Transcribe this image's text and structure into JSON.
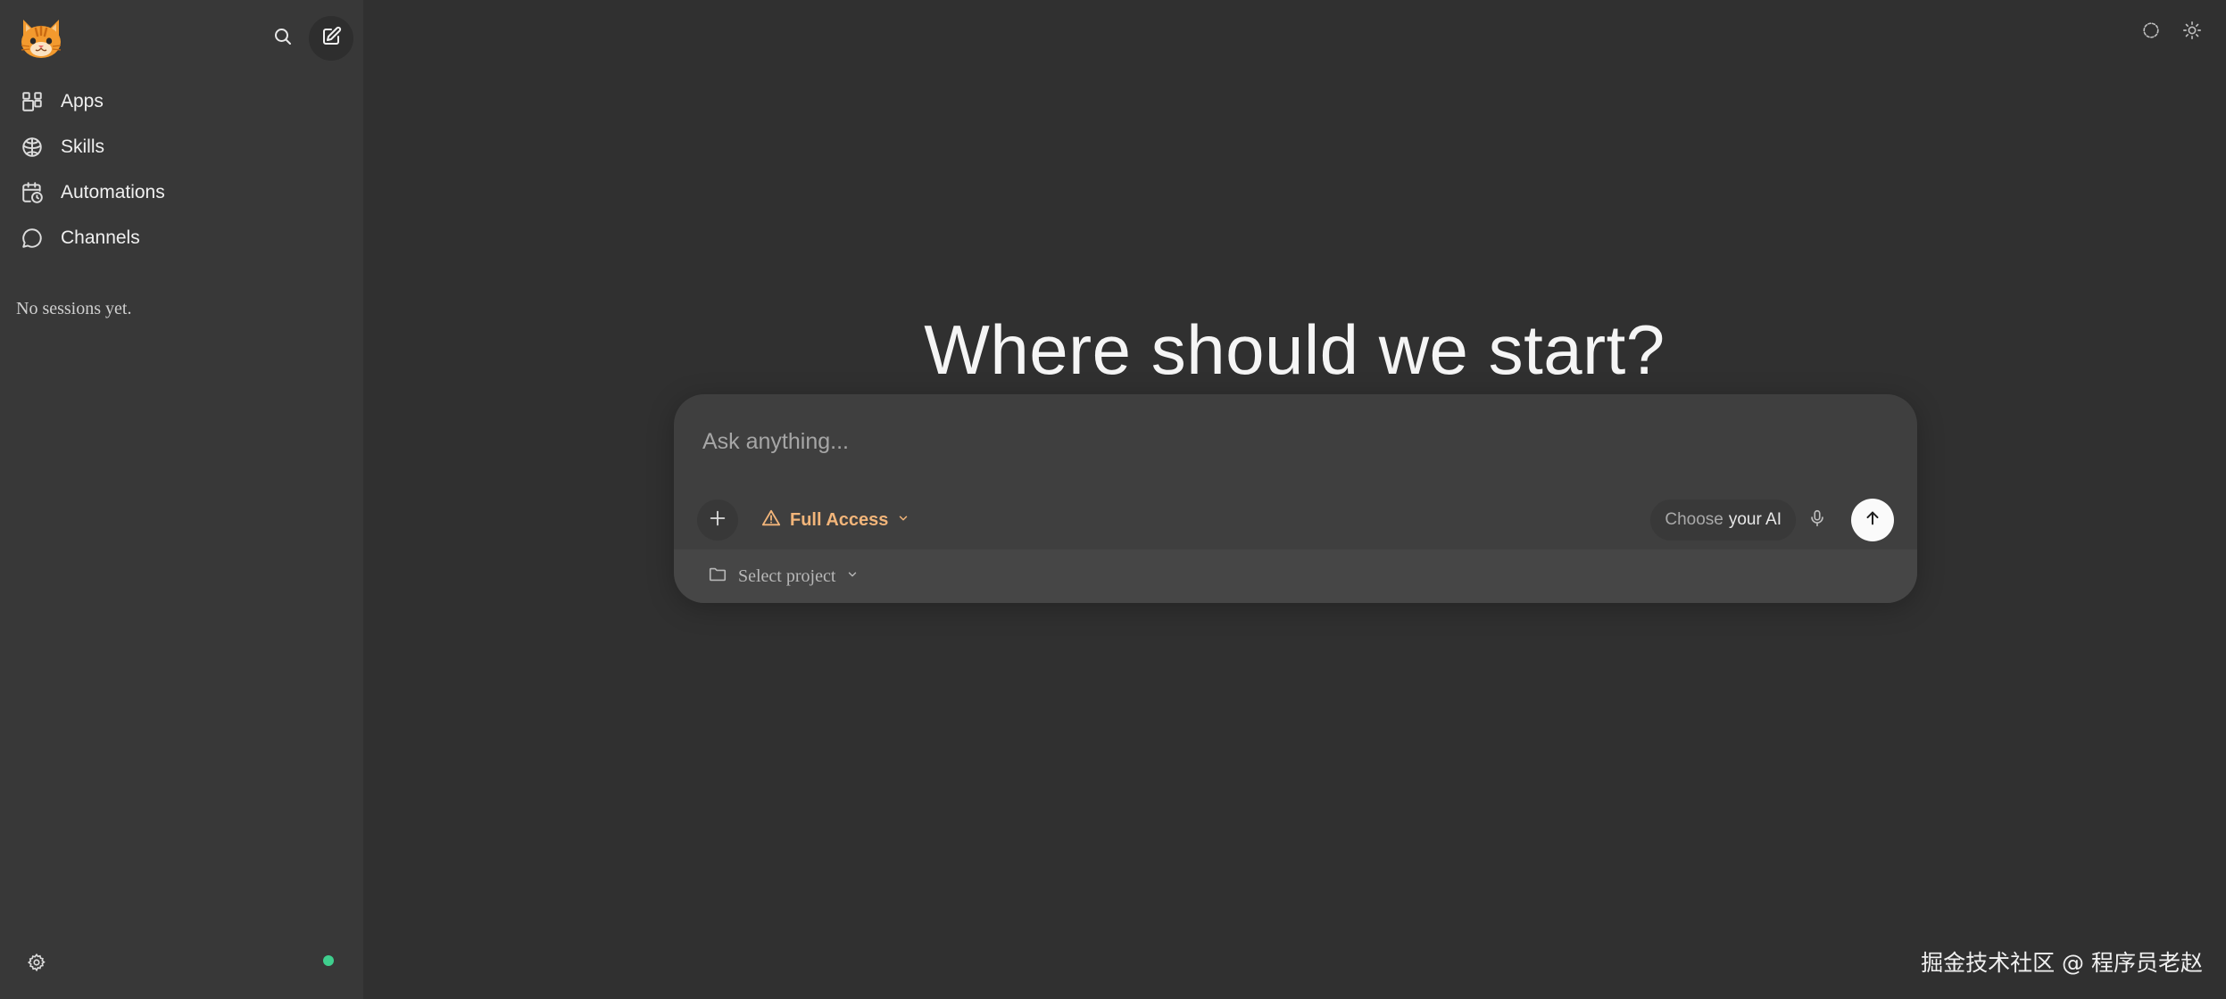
{
  "sidebar": {
    "logo_icon": "cat-face-icon",
    "search_icon": "search-icon",
    "new_session_icon": "edit-icon",
    "nav": [
      {
        "label": "Apps",
        "icon": "apps-icon"
      },
      {
        "label": "Skills",
        "icon": "brain-icon"
      },
      {
        "label": "Automations",
        "icon": "calendar-clock-icon"
      },
      {
        "label": "Channels",
        "icon": "chat-bubble-icon"
      }
    ],
    "empty_sessions": "No sessions yet.",
    "settings_icon": "gear-icon",
    "status_color": "#3fcf8e"
  },
  "header": {
    "icons": [
      "loading-circle-icon",
      "sun-icon"
    ]
  },
  "main": {
    "headline": "Where should we start?",
    "composer": {
      "placeholder": "Ask anything...",
      "access_label": "Full Access",
      "access_color": "#f2b57a",
      "model_prefix": "Choose",
      "model_suffix": "your AI",
      "project_label": "Select project"
    }
  },
  "watermark": "掘金技术社区 @ 程序员老赵"
}
